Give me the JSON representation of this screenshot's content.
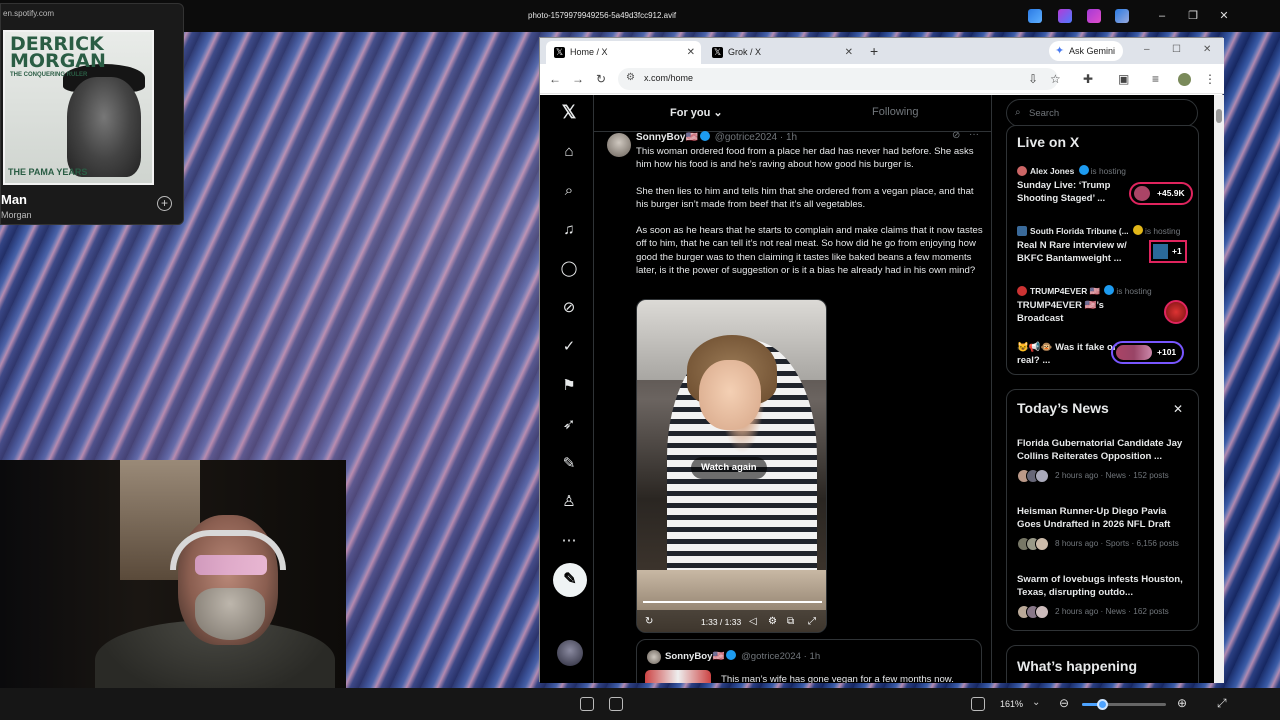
{
  "viewer": {
    "file_title": "photo-1579979949256-5a49d3fcc912.avif",
    "zoom": "161%"
  },
  "spotify": {
    "domain": "en.spotify.com",
    "art_title": "DERRICK MORGAN",
    "art_subtitle": "THE CONQUERING RULER",
    "art_bottom": "THE PAMA YEARS",
    "track": "Man",
    "artist": "Morgan"
  },
  "browser": {
    "tabs": [
      {
        "label": "Home / X"
      },
      {
        "label": "Grok / X"
      }
    ],
    "ask_gemini": "Ask Gemini",
    "url": "x.com/home"
  },
  "feed": {
    "tab_for_you": "For you",
    "tab_following": "Following",
    "post": {
      "name": "SonnyBoy🇺🇸",
      "handle": "@gotrice2024",
      "time": "· 1h",
      "paragraphs": [
        "This woman ordered food from a place her dad has never had before. She asks him how his food is and he’s raving about how good his burger is.",
        "She then lies to him and tells him that she ordered from a vegan place, and that his burger isn’t made from beef that it’s all vegetables.",
        "As soon as he hears that he starts to complain and make claims that it now tastes off to him, that he can tell it’s not real meat. So how did he go from enjoying how good the burger was to then claiming it tastes like baked beans a few moments later, is it the power of suggestion or is it a bias he already had in his own mind?"
      ],
      "watch_again": "Watch again",
      "video_time": "1:33 / 1:33"
    },
    "quote": {
      "name": "SonnyBoy🇺🇸",
      "handle": "@gotrice2024",
      "time": "· 1h",
      "text": "This man’s wife has gone vegan for a few months now."
    }
  },
  "sidebar": {
    "search_placeholder": "Search",
    "live_title": "Live on X",
    "live": [
      {
        "host": "Alex Jones",
        "hosting": "is hosting",
        "title": "Sunday Live: ‘Trump Shooting Staged’ ...",
        "count": "+45.9K"
      },
      {
        "host": "South Florida Tribune (...",
        "hosting": "is hosting",
        "title": "Real N Rare interview w/ BKFC Bantamweight ...",
        "count": "+1"
      },
      {
        "host": "TRUMP4EVER 🇺🇸",
        "hosting": "is hosting",
        "title": "TRUMP4EVER 🇺🇸’s Broadcast",
        "count": ""
      },
      {
        "host": "",
        "hosting": "",
        "title": "😺📢🐵 Was it fake or real? ...",
        "count": "+101"
      }
    ],
    "news_title": "Today’s News",
    "news": [
      {
        "title": "Florida Gubernatorial Candidate Jay Collins Reiterates Opposition ...",
        "meta": "2 hours ago · News · 152 posts"
      },
      {
        "title": "Heisman Runner-Up Diego Pavia Goes Undrafted in 2026 NFL Draft",
        "meta": "8 hours ago · Sports · 6,156 posts"
      },
      {
        "title": "Swarm of lovebugs infests Houston, Texas, disrupting outdo...",
        "meta": "2 hours ago · News · 162 posts"
      }
    ],
    "happening_title": "What’s happening"
  }
}
